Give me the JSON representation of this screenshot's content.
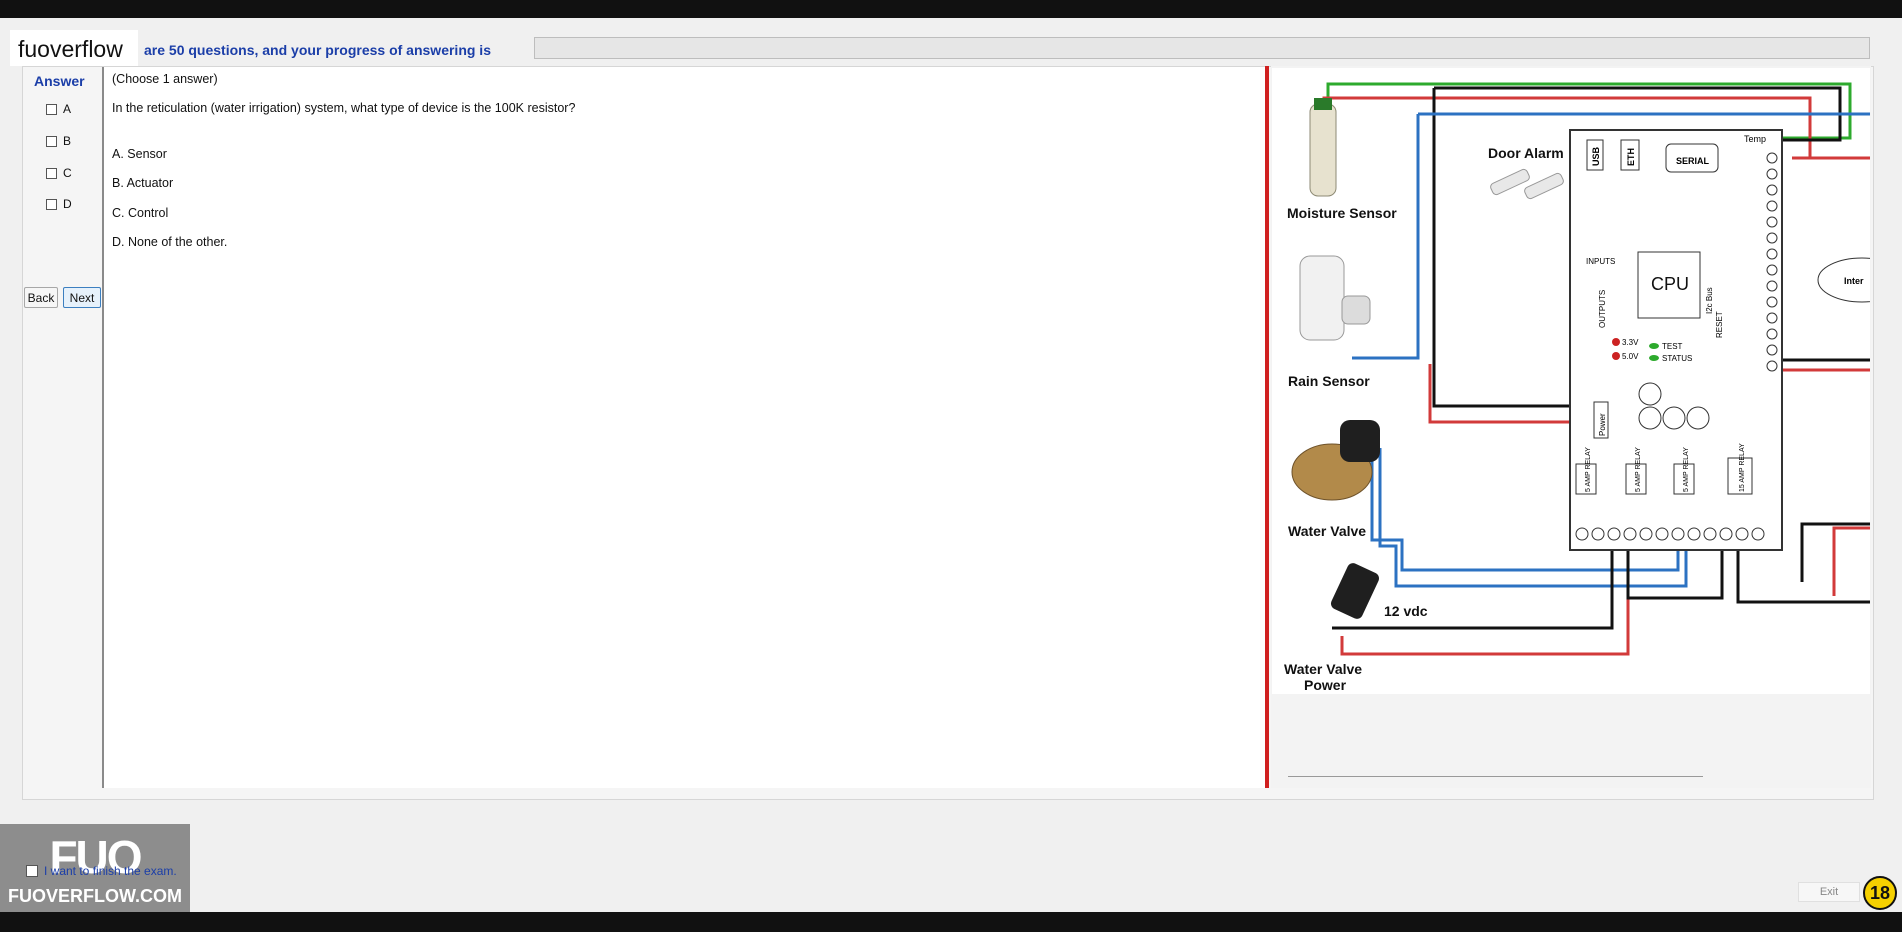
{
  "header": {
    "watermark": "fuoverflow",
    "progress_text": "are 50 questions, and your progress of answering is",
    "progress_fraction": 0
  },
  "answer_panel": {
    "heading": "Answer",
    "options": [
      "A",
      "B",
      "C",
      "D"
    ],
    "back_label": "Back",
    "next_label": "Next"
  },
  "question": {
    "instruction": "(Choose 1 answer)",
    "text": "In the reticulation  (water irrigation) system, what type of device is the 100K resistor?",
    "choices": [
      "A.  Sensor",
      "B.  Actuator",
      "C.  Control",
      "D.  None of the other."
    ]
  },
  "diagram": {
    "labels": {
      "moisture": "Moisture Sensor",
      "rain": "Rain Sensor",
      "valve": "Water Valve",
      "vdc": "12 vdc",
      "valve_power_1": "Water Valve",
      "valve_power_2": "Power",
      "door_alarm": "Door Alarm",
      "cpu": "CPU",
      "usb": "USB",
      "eth": "ETH",
      "serial": "SERIAL",
      "inputs": "INPUTS",
      "outputs": "OUTPUTS",
      "temp": "Temp",
      "reset": "RESET",
      "test": "TEST",
      "status": "STATUS",
      "v33": "3.3V",
      "v50": "5.0V",
      "power": "Power",
      "relay": "5 AMP RELAY",
      "relay15": "15 AMP RELAY",
      "i2c": "I2c Bus",
      "internet": "Inter"
    }
  },
  "footer": {
    "logo_mark": "FUO",
    "logo_name": "FUOVERFLOW.COM",
    "finish_label": "I want to finish the exam.",
    "exit_label": "Exit",
    "badge": "18"
  }
}
